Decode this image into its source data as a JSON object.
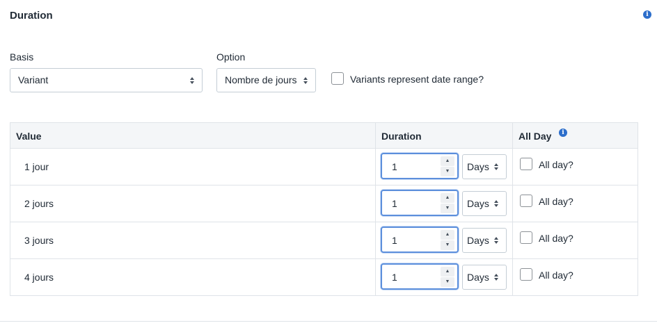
{
  "section": {
    "title": "Duration",
    "info_icon": "info-icon"
  },
  "basis": {
    "label": "Basis",
    "value": "Variant"
  },
  "option": {
    "label": "Option",
    "value": "Nombre de jours"
  },
  "date_range": {
    "label": "Variants represent date range?",
    "checked": false
  },
  "table": {
    "headers": {
      "value": "Value",
      "duration": "Duration",
      "all_day": "All Day"
    },
    "rows": [
      {
        "value": "1 jour",
        "duration": "1",
        "unit": "Days",
        "all_day_label": "All day?",
        "all_day": false
      },
      {
        "value": "2 jours",
        "duration": "1",
        "unit": "Days",
        "all_day_label": "All day?",
        "all_day": false
      },
      {
        "value": "3 jours",
        "duration": "1",
        "unit": "Days",
        "all_day_label": "All day?",
        "all_day": false
      },
      {
        "value": "4 jours",
        "duration": "1",
        "unit": "Days",
        "all_day_label": "All day?",
        "all_day": false
      }
    ]
  },
  "colors": {
    "accent": "#2c6ecb",
    "focus_border": "#5c8fdc",
    "border": "#c4cdd5",
    "header_bg": "#f4f6f8"
  }
}
